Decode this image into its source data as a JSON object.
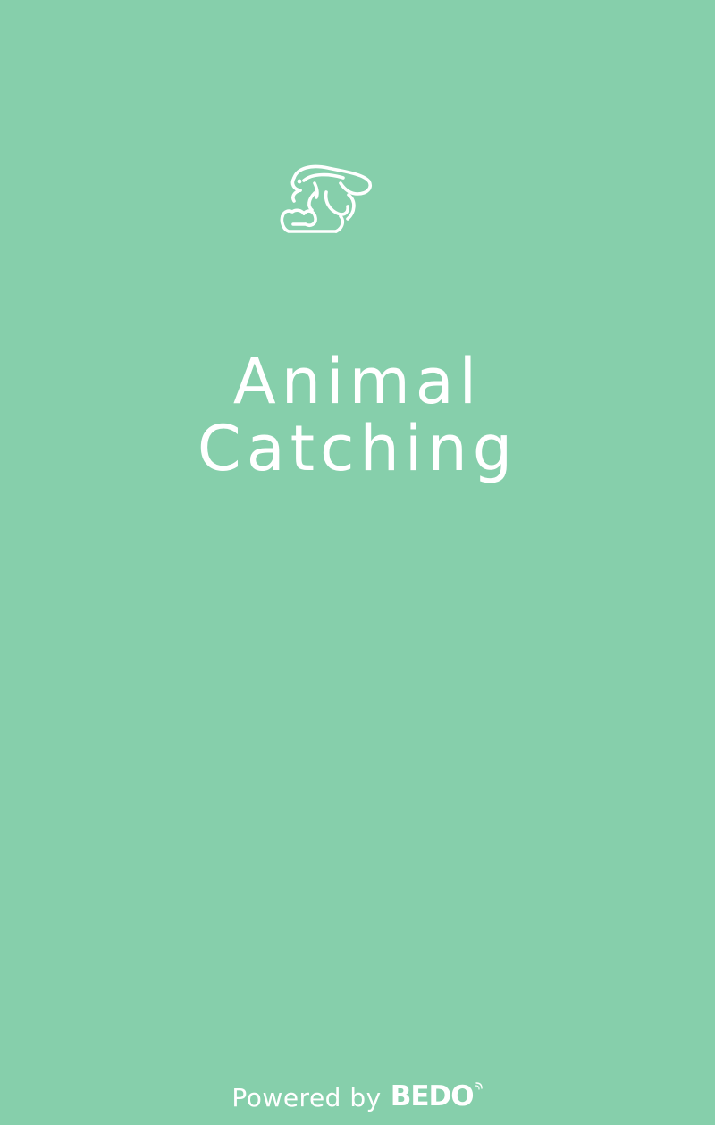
{
  "app": {
    "background_color": "#86cfab",
    "foreground_color": "#ffffff",
    "logo_icon": "rabbit-icon",
    "title_line_1": "Animal",
    "title_line_2": "Catching"
  },
  "footer": {
    "powered_by_label": "Powered by",
    "brand_name": "BEDO"
  }
}
